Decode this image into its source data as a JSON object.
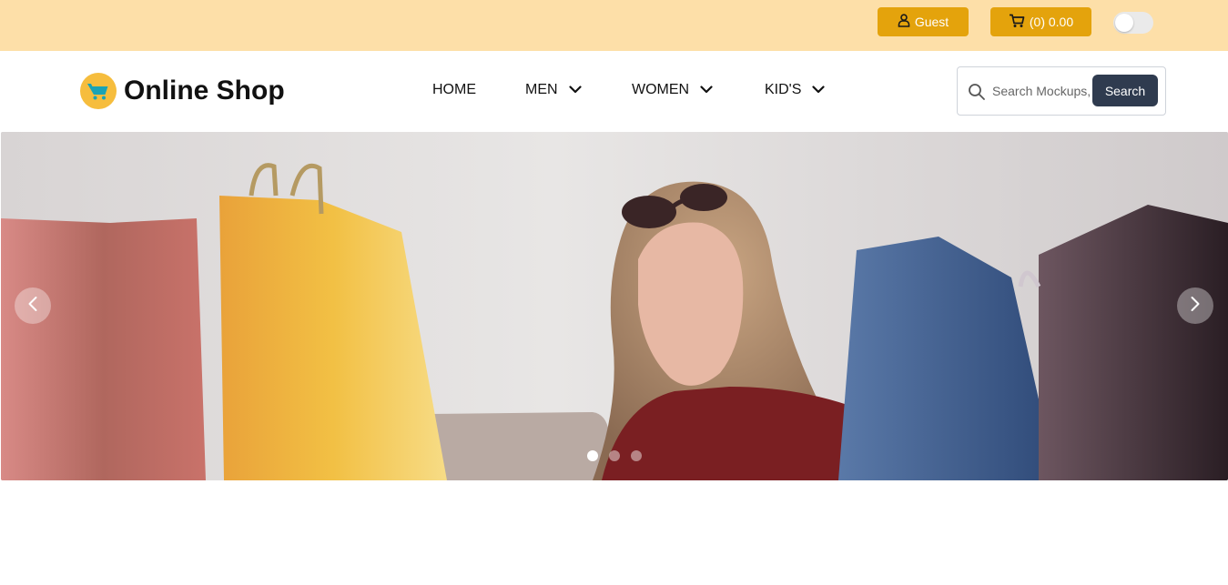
{
  "topbar": {
    "guest_label": "Guest",
    "cart_label": "(0) 0.00",
    "theme_toggle": "off"
  },
  "logo": {
    "text": "Online Shop"
  },
  "nav": {
    "items": [
      {
        "label": "HOME"
      },
      {
        "label": "MEN"
      },
      {
        "label": "WOMEN"
      },
      {
        "label": "KID'S"
      }
    ]
  },
  "search": {
    "placeholder": "Search Mockups, Logos...",
    "button_label": "Search"
  },
  "carousel": {
    "slide_count": 3,
    "active_slide": 1
  },
  "colors": {
    "topbar_bg": "#fddfa8",
    "accent": "#e4a30c",
    "search_button": "#2f3b4f"
  }
}
